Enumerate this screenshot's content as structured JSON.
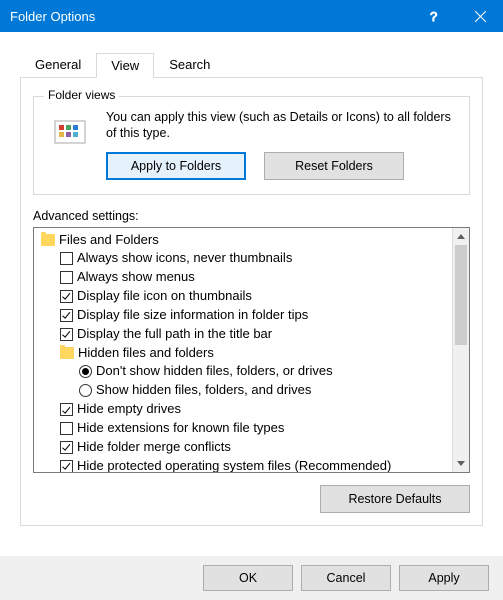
{
  "window": {
    "title": "Folder Options"
  },
  "tabs": {
    "general": "General",
    "view": "View",
    "search": "Search"
  },
  "folderViews": {
    "legend": "Folder views",
    "description": "You can apply this view (such as Details or Icons) to all folders of this type.",
    "apply": "Apply to Folders",
    "reset": "Reset Folders"
  },
  "advanced": {
    "label": "Advanced settings:",
    "rootLabel": "Files and Folders",
    "items": [
      {
        "type": "check",
        "checked": false,
        "label": "Always show icons, never thumbnails"
      },
      {
        "type": "check",
        "checked": false,
        "label": "Always show menus"
      },
      {
        "type": "check",
        "checked": true,
        "label": "Display file icon on thumbnails"
      },
      {
        "type": "check",
        "checked": true,
        "label": "Display file size information in folder tips"
      },
      {
        "type": "check",
        "checked": true,
        "label": "Display the full path in the title bar"
      }
    ],
    "hiddenGroup": {
      "label": "Hidden files and folders",
      "options": [
        {
          "selected": true,
          "label": "Don't show hidden files, folders, or drives"
        },
        {
          "selected": false,
          "label": "Show hidden files, folders, and drives"
        }
      ]
    },
    "items2": [
      {
        "type": "check",
        "checked": true,
        "label": "Hide empty drives"
      },
      {
        "type": "check",
        "checked": false,
        "label": "Hide extensions for known file types"
      },
      {
        "type": "check",
        "checked": true,
        "label": "Hide folder merge conflicts"
      },
      {
        "type": "check",
        "checked": true,
        "label": "Hide protected operating system files (Recommended)"
      }
    ],
    "restore": "Restore Defaults"
  },
  "footer": {
    "ok": "OK",
    "cancel": "Cancel",
    "apply": "Apply"
  }
}
